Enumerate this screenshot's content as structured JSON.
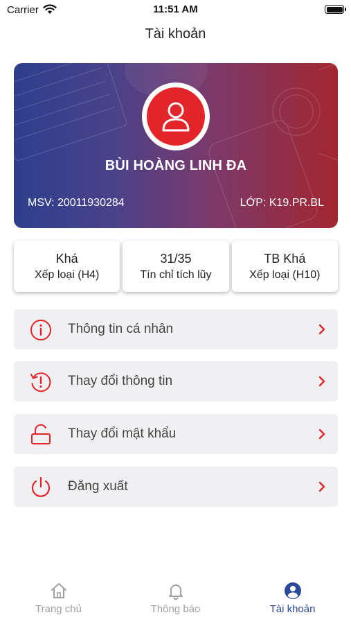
{
  "status_bar": {
    "carrier": "Carrier",
    "time": "11:51 AM"
  },
  "header": {
    "title": "Tài khoản"
  },
  "profile": {
    "name": "BÙI HOÀNG LINH ĐA",
    "student_id": "MSV: 20011930284",
    "class": "LỚP: K19.PR.BL"
  },
  "stats": [
    {
      "value": "Khá",
      "label": "Xếp loại (H4)"
    },
    {
      "value": "31/35",
      "label": "Tín chỉ tích lũy"
    },
    {
      "value": "TB Khá",
      "label": "Xếp loại (H10)"
    }
  ],
  "menu": [
    {
      "label": "Thông tin cá nhân",
      "icon": "info-icon"
    },
    {
      "label": "Thay đổi thông tin",
      "icon": "history-alert-icon"
    },
    {
      "label": "Thay đổi mật khẩu",
      "icon": "unlock-icon"
    },
    {
      "label": "Đăng xuất",
      "icon": "power-icon"
    }
  ],
  "tabs": [
    {
      "label": "Trang chủ",
      "icon": "home-icon",
      "active": false
    },
    {
      "label": "Thông báo",
      "icon": "bell-icon",
      "active": false
    },
    {
      "label": "Tài khoản",
      "icon": "account-icon",
      "active": true
    }
  ],
  "colors": {
    "accent_red": "#e1252a",
    "active_tab": "#2b4a9a",
    "inactive_tab": "#a0a0a0",
    "menu_bg": "#f0f0f3"
  }
}
